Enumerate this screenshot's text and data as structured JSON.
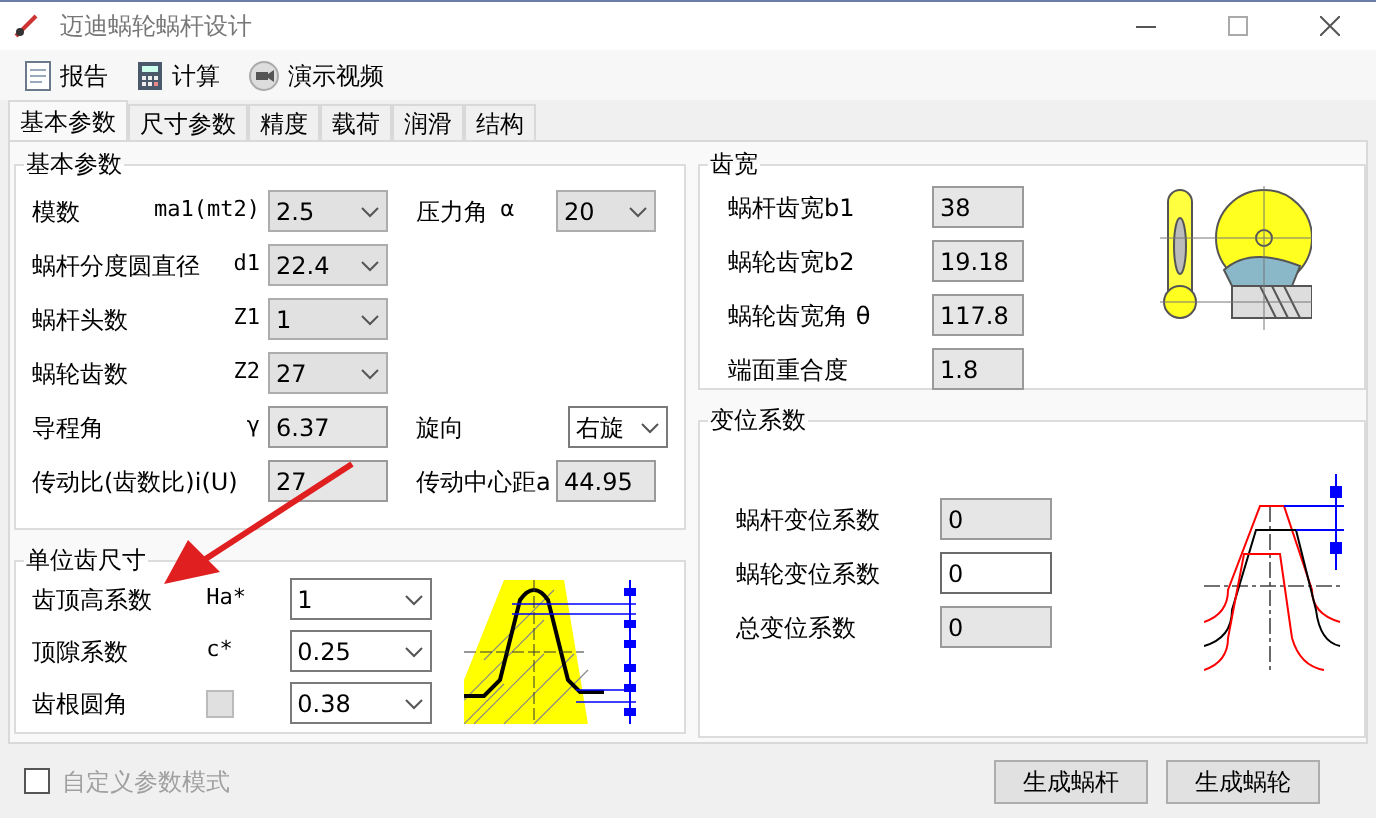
{
  "window": {
    "title": "迈迪蜗轮蜗杆设计"
  },
  "toolbar": [
    {
      "kind": "report",
      "label": "报告"
    },
    {
      "kind": "calculator",
      "label": "计算"
    },
    {
      "kind": "video",
      "label": "演示视频"
    }
  ],
  "tabs": [
    {
      "label": "基本参数",
      "selected": true
    },
    {
      "label": "尺寸参数",
      "selected": false
    },
    {
      "label": "精度",
      "selected": false
    },
    {
      "label": "载荷",
      "selected": false
    },
    {
      "label": "润滑",
      "selected": false
    },
    {
      "label": "结构",
      "selected": false
    }
  ],
  "basic_params": {
    "title": "基本参数",
    "rows": [
      {
        "left": {
          "label": "模数",
          "symbol": "ma1(mt2)",
          "field": {
            "kind": "dropdown",
            "value": "2.5",
            "editable": false
          }
        },
        "right": {
          "label": "压力角",
          "symbol": "α",
          "field": {
            "kind": "dropdown",
            "value": "20",
            "editable": false
          }
        }
      },
      {
        "left": {
          "label": "蜗杆分度圆直径",
          "symbol": "d1",
          "field": {
            "kind": "dropdown",
            "value": "22.4",
            "editable": false
          }
        }
      },
      {
        "left": {
          "label": "蜗杆头数",
          "symbol": "Z1",
          "field": {
            "kind": "dropdown",
            "value": "1",
            "editable": false
          }
        }
      },
      {
        "left": {
          "label": "蜗轮齿数",
          "symbol": "Z2",
          "field": {
            "kind": "dropdown",
            "value": "27",
            "editable": false
          }
        }
      },
      {
        "left": {
          "label": "导程角",
          "symbol": "γ",
          "field": {
            "kind": "textbox",
            "value": "6.37",
            "editable": false
          }
        },
        "right": {
          "label": "旋向",
          "field": {
            "kind": "dropdown",
            "value": "右旋",
            "editable": true
          }
        }
      },
      {
        "left": {
          "label": "传动比(齿数比)i(U)",
          "field": {
            "kind": "textbox",
            "value": "27",
            "editable": false
          }
        },
        "right": {
          "label": "传动中心距a",
          "field": {
            "kind": "textbox",
            "value": "44.95",
            "editable": false
          }
        }
      }
    ]
  },
  "unit_tooth": {
    "title": "单位齿尺寸",
    "rows": [
      {
        "label": "齿顶高系数",
        "symbol": "Ha*",
        "field": {
          "kind": "dropdown",
          "value": "1",
          "editable": true
        }
      },
      {
        "label": "顶隙系数",
        "symbol": "c*",
        "field": {
          "kind": "dropdown",
          "value": "0.25",
          "editable": true
        }
      },
      {
        "label": "齿根圆角",
        "swatch": true,
        "field": {
          "kind": "dropdown",
          "value": "0.38",
          "editable": true
        }
      }
    ]
  },
  "tooth_width": {
    "title": "齿宽",
    "rows": [
      {
        "label": "蜗杆齿宽b1",
        "field": {
          "kind": "textbox",
          "value": "38",
          "editable": false
        }
      },
      {
        "label": "蜗轮齿宽b2",
        "field": {
          "kind": "textbox",
          "value": "19.18",
          "editable": false
        }
      },
      {
        "label": "蜗轮齿宽角 θ",
        "field": {
          "kind": "textbox",
          "value": "117.8",
          "editable": false
        }
      },
      {
        "label": "端面重合度",
        "field": {
          "kind": "textbox",
          "value": "1.8",
          "editable": false
        }
      }
    ]
  },
  "shift": {
    "title": "变位系数",
    "rows": [
      {
        "label": "蜗杆变位系数",
        "field": {
          "kind": "textbox",
          "value": "0",
          "editable": false
        }
      },
      {
        "label": "蜗轮变位系数",
        "field": {
          "kind": "textbox",
          "value": "0",
          "editable": true
        }
      },
      {
        "label": "总变位系数",
        "field": {
          "kind": "textbox",
          "value": "0",
          "editable": false
        }
      }
    ]
  },
  "custom_mode": {
    "label": "自定义参数模式",
    "checked": false,
    "disabled": true
  },
  "buttons": [
    "生成蜗杆",
    "生成蜗轮"
  ]
}
